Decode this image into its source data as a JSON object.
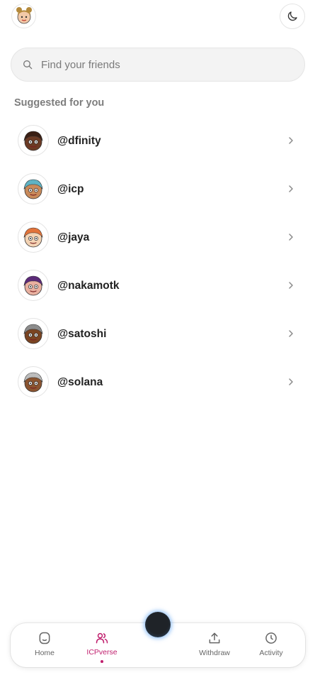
{
  "search": {
    "placeholder": "Find your friends"
  },
  "section": {
    "title": "Suggested for you"
  },
  "friends": [
    {
      "handle": "@dfinity",
      "avatar": "avatar-dfinity",
      "skin": "#6b3a24",
      "hair": "#3a1f14"
    },
    {
      "handle": "@icp",
      "avatar": "avatar-icp",
      "skin": "#c98a5a",
      "hair": "#5fb3c4"
    },
    {
      "handle": "@jaya",
      "avatar": "avatar-jaya",
      "skin": "#f3d3b4",
      "hair": "#e2733a"
    },
    {
      "handle": "@nakamotk",
      "avatar": "avatar-nakamotk",
      "skin": "#e8b0a0",
      "hair": "#5b2a78"
    },
    {
      "handle": "@satoshi",
      "avatar": "avatar-satoshi",
      "skin": "#7a4422",
      "hair": "#8c8c8c"
    },
    {
      "handle": "@solana",
      "avatar": "avatar-solana",
      "skin": "#8a5430",
      "hair": "#bcbcbc"
    }
  ],
  "nav": {
    "items": [
      {
        "label": "Home",
        "icon": "home-icon",
        "active": false
      },
      {
        "label": "ICPverse",
        "icon": "people-icon",
        "active": true
      },
      {
        "label": "Withdraw",
        "icon": "upload-icon",
        "active": false
      },
      {
        "label": "Activity",
        "icon": "clock-icon",
        "active": false
      }
    ]
  },
  "colors": {
    "accent": "#c0206e",
    "orb_glow": "#3a86d6"
  }
}
